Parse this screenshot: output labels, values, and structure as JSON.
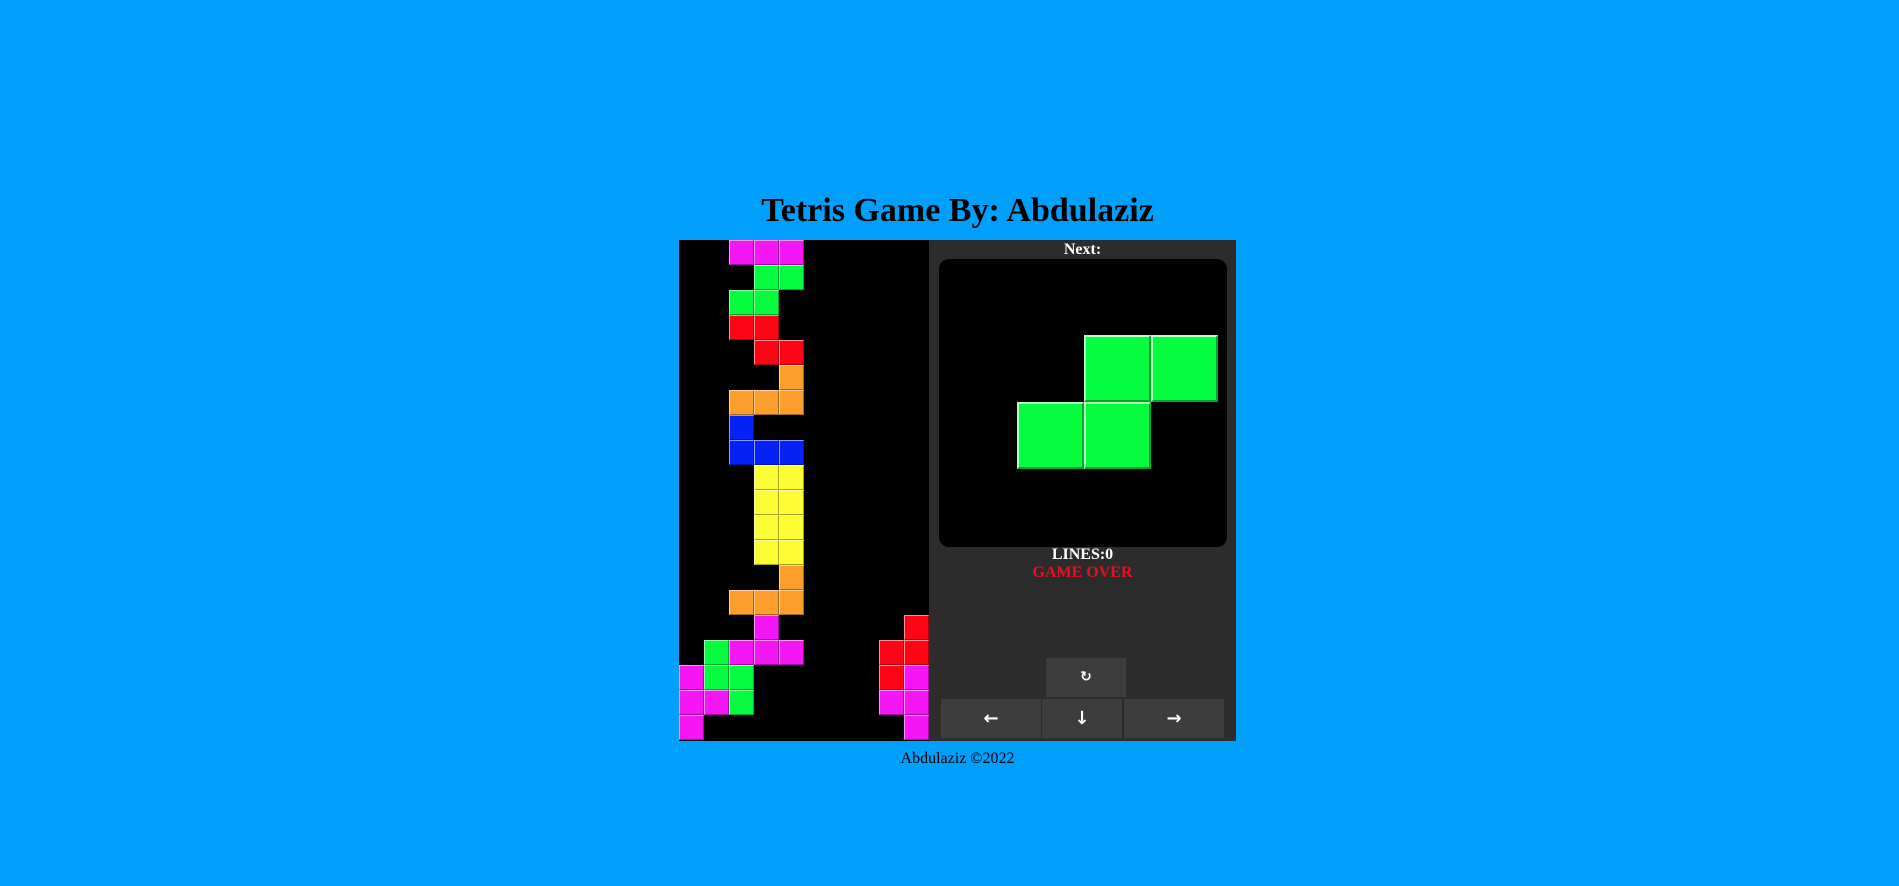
{
  "title": "Tetris Game By: Abdulaziz",
  "next_label": "Next:",
  "lines_text": "LINES:0",
  "status_text": "GAME OVER",
  "footer_text": "Abdulaziz ©2022",
  "controls": {
    "rotate": "↻",
    "left": "←",
    "down": "↓",
    "right": "→"
  },
  "colors": {
    "background": "#009ffc",
    "panel": "#2c2c2c",
    "board": "#000000",
    "magenta": "#f516f5",
    "green": "#06fc3e",
    "red": "#fc0616",
    "orange": "#fb9e2c",
    "blue": "#0522f7",
    "yellow": "#fcfc34",
    "game_over": "#e8101b"
  },
  "board": {
    "columns": 10,
    "rows": 20,
    "cells": [
      {
        "col": 2,
        "row": 0,
        "color": "magenta"
      },
      {
        "col": 3,
        "row": 0,
        "color": "magenta"
      },
      {
        "col": 4,
        "row": 0,
        "color": "magenta"
      },
      {
        "col": 3,
        "row": 1,
        "color": "green"
      },
      {
        "col": 4,
        "row": 1,
        "color": "green"
      },
      {
        "col": 2,
        "row": 2,
        "color": "green"
      },
      {
        "col": 3,
        "row": 2,
        "color": "green"
      },
      {
        "col": 2,
        "row": 3,
        "color": "red"
      },
      {
        "col": 3,
        "row": 3,
        "color": "red"
      },
      {
        "col": 3,
        "row": 4,
        "color": "red"
      },
      {
        "col": 4,
        "row": 4,
        "color": "red"
      },
      {
        "col": 4,
        "row": 5,
        "color": "orange"
      },
      {
        "col": 2,
        "row": 6,
        "color": "orange"
      },
      {
        "col": 3,
        "row": 6,
        "color": "orange"
      },
      {
        "col": 4,
        "row": 6,
        "color": "orange"
      },
      {
        "col": 2,
        "row": 7,
        "color": "blue"
      },
      {
        "col": 2,
        "row": 8,
        "color": "blue"
      },
      {
        "col": 3,
        "row": 8,
        "color": "blue"
      },
      {
        "col": 4,
        "row": 8,
        "color": "blue"
      },
      {
        "col": 3,
        "row": 9,
        "color": "yellow"
      },
      {
        "col": 4,
        "row": 9,
        "color": "yellow"
      },
      {
        "col": 3,
        "row": 10,
        "color": "yellow"
      },
      {
        "col": 4,
        "row": 10,
        "color": "yellow"
      },
      {
        "col": 3,
        "row": 11,
        "color": "yellow"
      },
      {
        "col": 4,
        "row": 11,
        "color": "yellow"
      },
      {
        "col": 3,
        "row": 12,
        "color": "yellow"
      },
      {
        "col": 4,
        "row": 12,
        "color": "yellow"
      },
      {
        "col": 4,
        "row": 13,
        "color": "orange"
      },
      {
        "col": 2,
        "row": 14,
        "color": "orange"
      },
      {
        "col": 3,
        "row": 14,
        "color": "orange"
      },
      {
        "col": 4,
        "row": 14,
        "color": "orange"
      },
      {
        "col": 3,
        "row": 15,
        "color": "magenta"
      },
      {
        "col": 9,
        "row": 15,
        "color": "red"
      },
      {
        "col": 1,
        "row": 16,
        "color": "green"
      },
      {
        "col": 2,
        "row": 16,
        "color": "magenta"
      },
      {
        "col": 3,
        "row": 16,
        "color": "magenta"
      },
      {
        "col": 4,
        "row": 16,
        "color": "magenta"
      },
      {
        "col": 8,
        "row": 16,
        "color": "red"
      },
      {
        "col": 9,
        "row": 16,
        "color": "red"
      },
      {
        "col": 0,
        "row": 17,
        "color": "magenta"
      },
      {
        "col": 1,
        "row": 17,
        "color": "green"
      },
      {
        "col": 2,
        "row": 17,
        "color": "green"
      },
      {
        "col": 8,
        "row": 17,
        "color": "red"
      },
      {
        "col": 9,
        "row": 17,
        "color": "magenta"
      },
      {
        "col": 0,
        "row": 18,
        "color": "magenta"
      },
      {
        "col": 1,
        "row": 18,
        "color": "magenta"
      },
      {
        "col": 2,
        "row": 18,
        "color": "green"
      },
      {
        "col": 8,
        "row": 18,
        "color": "magenta"
      },
      {
        "col": 9,
        "row": 18,
        "color": "magenta"
      },
      {
        "col": 0,
        "row": 19,
        "color": "magenta"
      },
      {
        "col": 9,
        "row": 19,
        "color": "magenta"
      }
    ]
  },
  "next_piece": {
    "name": "S",
    "color": "green",
    "cells": [
      {
        "col": 2,
        "row": 1
      },
      {
        "col": 3,
        "row": 1
      },
      {
        "col": 1,
        "row": 2
      },
      {
        "col": 2,
        "row": 2
      }
    ]
  }
}
